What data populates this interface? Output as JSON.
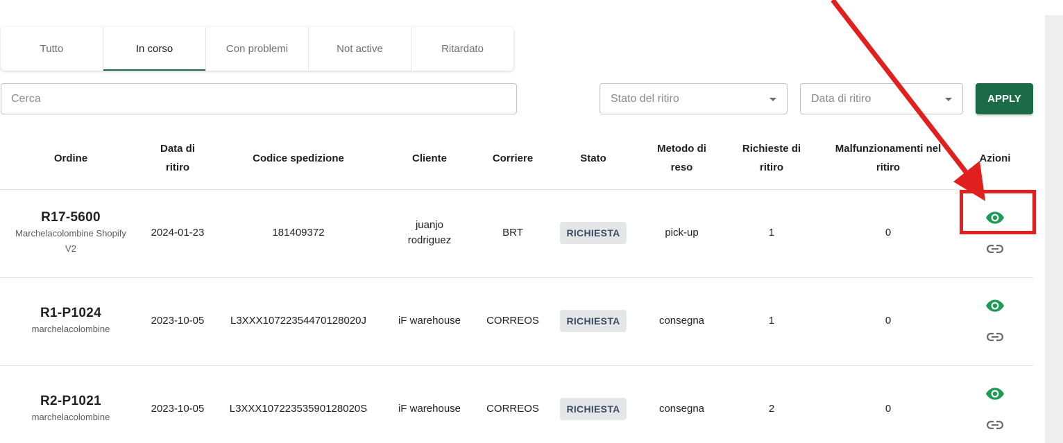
{
  "tabs": [
    {
      "label": "Tutto",
      "active": false
    },
    {
      "label": "In corso",
      "active": true
    },
    {
      "label": "Con problemi",
      "active": false
    },
    {
      "label": "Not active",
      "active": false
    },
    {
      "label": "Ritardato",
      "active": false
    }
  ],
  "filters": {
    "search_placeholder": "Cerca",
    "status_select": "Stato del ritiro",
    "date_select": "Data di ritiro",
    "apply_label": "APPLY"
  },
  "table": {
    "headers": {
      "ordine": "Ordine",
      "data_ritiro": "Data di ritiro",
      "codice": "Codice spedizione",
      "cliente": "Cliente",
      "corriere": "Corriere",
      "stato": "Stato",
      "metodo": "Metodo di reso",
      "richieste": "Richieste di ritiro",
      "malfunzionamenti": "Malfunzionamenti nel ritiro",
      "azioni": "Azioni"
    },
    "rows": [
      {
        "order_id": "R17-5600",
        "shop": "Marchelacolombine Shopify V2",
        "date": "2024-01-23",
        "code": "181409372",
        "client": "juanjo rodriguez",
        "carrier": "BRT",
        "status": "RICHIESTA",
        "method": "pick-up",
        "requests": "1",
        "failures": "0"
      },
      {
        "order_id": "R1-P1024",
        "shop": "marchelacolombine",
        "date": "2023-10-05",
        "code": "L3XXX10722354470128020J",
        "client": "iF warehouse",
        "carrier": "CORREOS",
        "status": "RICHIESTA",
        "method": "consegna",
        "requests": "1",
        "failures": "0"
      },
      {
        "order_id": "R2-P1021",
        "shop": "marchelacolombine",
        "date": "2023-10-05",
        "code": "L3XXX10722353590128020S",
        "client": "iF warehouse",
        "carrier": "CORREOS",
        "status": "RICHIESTA",
        "method": "consegna",
        "requests": "2",
        "failures": "0"
      }
    ]
  },
  "icons": {
    "view": "eye-icon",
    "link": "link-icon"
  },
  "colors": {
    "primary": "#1b6b49",
    "view_icon": "#1e9a55",
    "link_icon": "#6b6b6b",
    "badge_bg": "#e4e6e8",
    "badge_text": "#3a4d63",
    "annotation": "#e0201f"
  }
}
